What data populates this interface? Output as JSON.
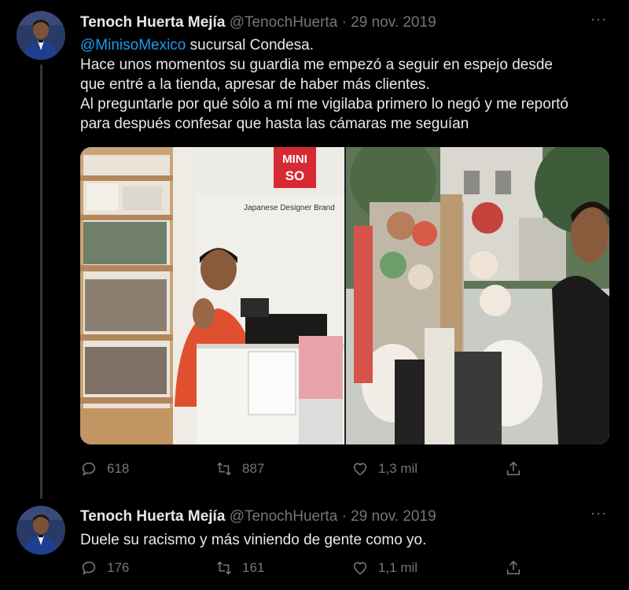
{
  "tweets": [
    {
      "author_name": "Tenoch Huerta Mejía",
      "handle": "@TenochHuerta",
      "separator": "·",
      "date": "29 nov. 2019",
      "more": "···",
      "mention": "@MinisoMexico",
      "lines": [
        " sucursal Condesa.",
        "Hace unos momentos su guardia me empezó a seguir en espejo desde",
        "que entré a la tienda, apresar de haber más clientes.",
        "Al preguntarle por qué sólo a mí me vigilaba primero lo negó y me reportó",
        "para después confesar que hasta las cámaras me seguían"
      ],
      "photo_sign_top": "MINI",
      "photo_sign_bottom": "SO",
      "photo_wall_text": "Japanese Designer Brand",
      "replies": "618",
      "retweets": "887",
      "likes": "1,3 mil"
    },
    {
      "author_name": "Tenoch Huerta Mejía",
      "handle": "@TenochHuerta",
      "separator": "·",
      "date": "29 nov. 2019",
      "more": "···",
      "text": "Duele su racismo y más viniendo de gente como yo.",
      "replies": "176",
      "retweets": "161",
      "likes": "1,1 mil"
    }
  ],
  "colors": {
    "background": "#000000",
    "text": "#e7e9ea",
    "muted": "#71767b",
    "mention": "#1d9bf0",
    "thread_line": "#333639"
  },
  "icons": [
    "reply-icon",
    "retweet-icon",
    "like-icon",
    "share-icon",
    "more-icon"
  ]
}
